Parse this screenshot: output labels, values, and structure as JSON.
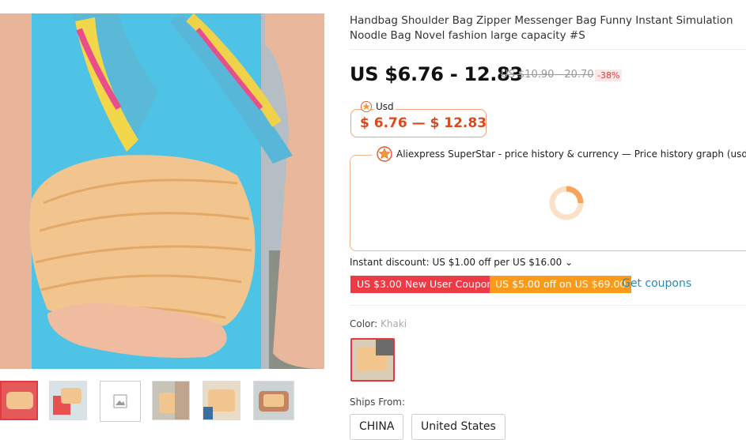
{
  "product": {
    "title": "Handbag Shoulder Bag Zipper Messenger Bag Funny Instant Simulation Noodle Bag Novel fashion large capacity #S",
    "price_range": "US $6.76 - 12.83",
    "original_price": "US $10.90 - 20.70",
    "discount_badge": "-38%"
  },
  "currency_widget": {
    "label": "Usd",
    "range": "$ 6.76 — $ 12.83"
  },
  "price_history": {
    "header": "Aliexpress SuperStar - price history & currency — Price history graph (usd)"
  },
  "instant_discount": "Instant discount: US $1.00 off per US $16.00 ⌄",
  "coupons": {
    "new_user": "US $3.00 New User Coupon",
    "store": "US $5.00 off on US $69.00",
    "get_link": "Get coupons"
  },
  "color": {
    "label": "Color: ",
    "value": "Khaki"
  },
  "ships_from": {
    "label": "Ships From:",
    "options": [
      "CHINA",
      "United States"
    ]
  },
  "colors": {
    "accent": "#e4393c",
    "orange": "#fa9a1a",
    "price_orange": "#d94a1c",
    "link": "#2a88b8"
  },
  "icons": [
    "superstar-star-icon",
    "loading-spinner-icon",
    "image-placeholder-icon"
  ]
}
